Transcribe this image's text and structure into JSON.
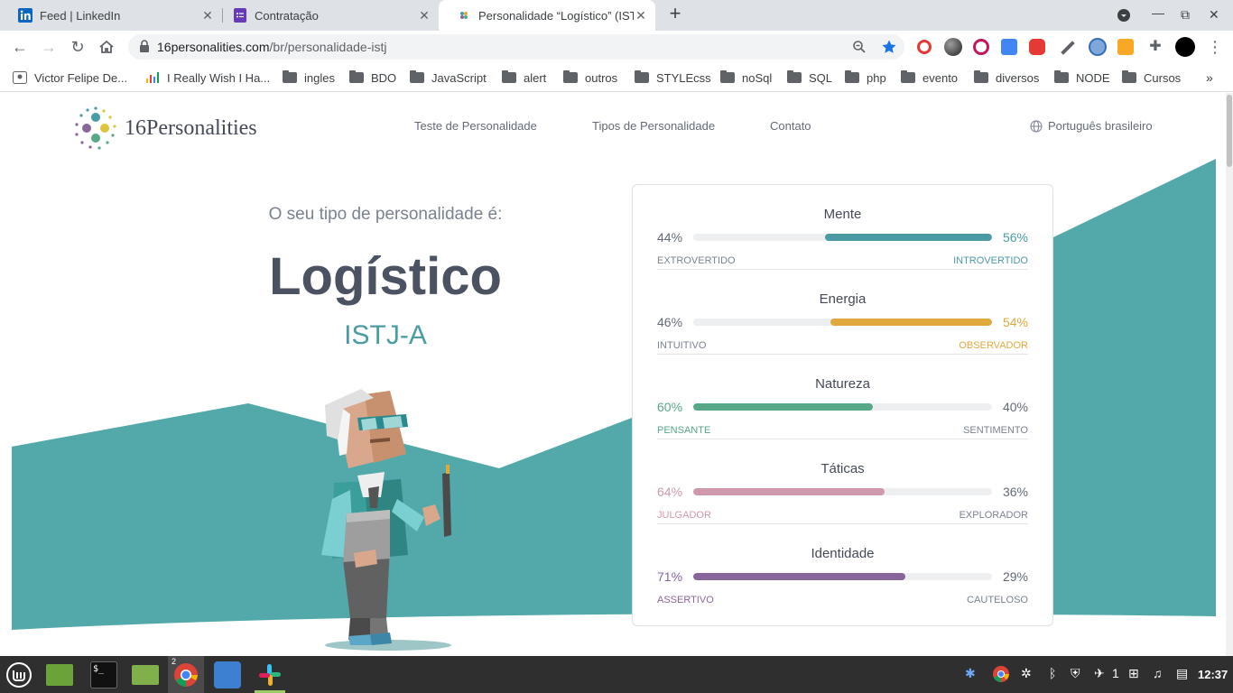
{
  "browser": {
    "tabs": [
      {
        "title": "Feed | LinkedIn",
        "favicon": "linkedin-icon",
        "active": false
      },
      {
        "title": "Contratação",
        "favicon": "forms-icon",
        "active": false
      },
      {
        "title": "Personalidade “Logístico” (IST",
        "favicon": "16personalities-icon",
        "active": true
      }
    ],
    "url_host": "16personalities.com",
    "url_path": "/br/personalidade-istj",
    "bookmarks": [
      {
        "label": "Victor Felipe De...",
        "icon": "profile-icon"
      },
      {
        "label": "I Really Wish I Ha...",
        "icon": "bars-icon"
      },
      {
        "label": "ingles",
        "icon": "folder-icon"
      },
      {
        "label": "BDO",
        "icon": "folder-icon"
      },
      {
        "label": "JavaScript",
        "icon": "folder-icon"
      },
      {
        "label": "alert",
        "icon": "folder-icon"
      },
      {
        "label": "outros",
        "icon": "folder-icon"
      },
      {
        "label": "STYLEcss",
        "icon": "folder-icon"
      },
      {
        "label": "noSql",
        "icon": "folder-icon"
      },
      {
        "label": "SQL",
        "icon": "folder-icon"
      },
      {
        "label": "php",
        "icon": "folder-icon"
      },
      {
        "label": "evento",
        "icon": "folder-icon"
      },
      {
        "label": "diversos",
        "icon": "folder-icon"
      },
      {
        "label": "NODE",
        "icon": "folder-icon"
      },
      {
        "label": "Cursos",
        "icon": "folder-icon"
      }
    ]
  },
  "site": {
    "logo_text": "16Personalities",
    "nav": [
      "Teste de Personalidade",
      "Tipos de Personalidade",
      "Contato"
    ],
    "language": "Português brasileiro"
  },
  "result": {
    "intro": "O seu tipo de personalidade é:",
    "type_name": "Logístico",
    "type_code": "ISTJ-A"
  },
  "traits": [
    {
      "name": "Mente",
      "left_pct": "44%",
      "right_pct": "56%",
      "left_label": "EXTROVERTIDO",
      "right_label": "INTROVERTIDO",
      "dominant": "right",
      "value": 56,
      "color": "#4a9ba4"
    },
    {
      "name": "Energia",
      "left_pct": "46%",
      "right_pct": "54%",
      "left_label": "INTUITIVO",
      "right_label": "OBSERVADOR",
      "dominant": "right",
      "value": 54,
      "color": "#e0a93d"
    },
    {
      "name": "Natureza",
      "left_pct": "60%",
      "right_pct": "40%",
      "left_label": "PENSANTE",
      "right_label": "SENTIMENTO",
      "dominant": "left",
      "value": 60,
      "color": "#56a886"
    },
    {
      "name": "Táticas",
      "left_pct": "64%",
      "right_pct": "36%",
      "left_label": "JULGADOR",
      "right_label": "EXPLORADOR",
      "dominant": "left",
      "value": 64,
      "color": "#d098ac"
    },
    {
      "name": "Identidade",
      "left_pct": "71%",
      "right_pct": "29%",
      "left_label": "ASSERTIVO",
      "right_label": "CAUTELOSO",
      "dominant": "left",
      "value": 71,
      "color": "#88659a"
    }
  ],
  "taskbar": {
    "tray_count": "1",
    "clock": "12:37",
    "chrome_badge": "2"
  }
}
